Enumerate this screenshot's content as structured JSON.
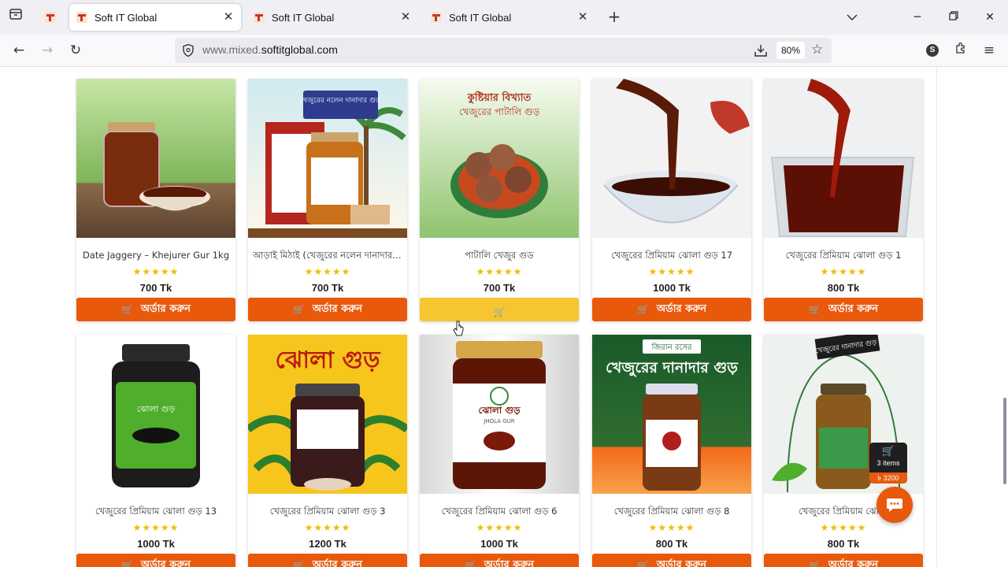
{
  "browser": {
    "tabs": [
      {
        "title": "Soft IT Global",
        "active": true
      },
      {
        "title": "Soft IT Global",
        "active": false
      },
      {
        "title": "Soft IT Global",
        "active": false
      }
    ],
    "url_prefix": "www.mixed.",
    "url_domain": "softitglobal.com",
    "zoom": "80%",
    "profile_initial": "S"
  },
  "products": [
    {
      "name": "Date Jaggery – Khejurer Gur 1kg",
      "price": "700 Tk",
      "order_label": "অর্ডার করুন",
      "rating": 5
    },
    {
      "name": "আড়াই মিঠাই (খেজুরের নলেন দানাদার ...",
      "price": "700 Tk",
      "order_label": "অর্ডার করুন",
      "rating": 5
    },
    {
      "name": "পাটালি খেজুর গুড",
      "price": "700 Tk",
      "order_label": "",
      "rating": 5
    },
    {
      "name": "খেজুরের প্রিমিয়াম ঝোলা গুড় 17",
      "price": "1000 Tk",
      "order_label": "অর্ডার করুন",
      "rating": 5
    },
    {
      "name": "খেজুরের প্রিমিয়াম ঝোলা গুড় 1",
      "price": "800 Tk",
      "order_label": "অর্ডার করুন",
      "rating": 5
    },
    {
      "name": "খেজুরের প্রিমিয়াম ঝোলা গুড় 13",
      "price": "1000 Tk",
      "order_label": "অর্ডার করুন",
      "rating": 5
    },
    {
      "name": "খেজুরের প্রিমিয়াম ঝোলা গুড় 3",
      "price": "1200 Tk",
      "order_label": "অর্ডার করুন",
      "rating": 5
    },
    {
      "name": "খেজুরের প্রিমিয়াম ঝোলা গুড় 6",
      "price": "1000 Tk",
      "order_label": "অর্ডার করুন",
      "rating": 5
    },
    {
      "name": "খেজুরের প্রিমিয়াম ঝোলা গুড় 8",
      "price": "800 Tk",
      "order_label": "অর্ডার করুন",
      "rating": 5
    },
    {
      "name": "খেজুরের প্রিমিয়াম ঝোলা",
      "price": "800 Tk",
      "order_label": "অর্ডার করুন",
      "rating": 5
    }
  ],
  "image_texts": {
    "p2": "খেজুরের নলেন দানাদার গুড়",
    "p3_line1": "কুষ্টিয়ার বিখ্যাত",
    "p3_line2": "খেজুরের পাটালি গুড়",
    "p6": "ঝোলা গুড়",
    "p7": "ঝোলা গুড়",
    "p8_line1": "ঝোলা গুড়",
    "p8_line2": "JHOLA GUR",
    "p9_line1": "জিরান রসের",
    "p9_line2": "খেজুরের দানাদার গুড়",
    "p10": "খেজুরের দানাদার গুড়"
  },
  "mini_cart": {
    "count": "3 items",
    "total": "৳ 3200"
  },
  "colors": {
    "order_button": "#e8590c",
    "order_button_hover": "#f6c531",
    "star": "#f5b800"
  }
}
